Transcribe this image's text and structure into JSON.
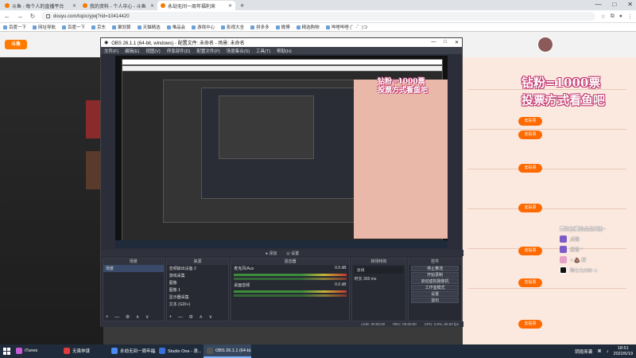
{
  "browser": {
    "tabs": [
      {
        "label": "斗鱼 - 每个人的直播平台",
        "active": false
      },
      {
        "label": "我的资料 - 个人中心 - 斗鱼",
        "active": false
      },
      {
        "label": "永劫无间一周年福利来",
        "active": true
      }
    ],
    "new_tab": "+",
    "window_controls": [
      "—",
      "□",
      "✕"
    ],
    "url": "douyu.com/topic/yjwj?rid=10414420",
    "bookmarks": [
      "百度一下",
      "网址导航",
      "百度一下",
      "京东",
      "聚划算",
      "天猫精选",
      "唯品会",
      "游戏中心",
      "影视大全",
      "拼多多",
      "微博",
      "精选购物",
      "哔哩哔哩 (゜-゜)つ"
    ]
  },
  "stream_overlay": {
    "title_line1": "钻粉=1000票",
    "title_line2": "投票方式看鱼吧",
    "follow_header": "喜欢主播的点点关注~",
    "follow_items": [
      "点歌",
      "房管 *",
      "+ 💩 群",
      "嗨七七030 ★"
    ]
  },
  "obs": {
    "title": "OBS 26.1.1 (64-bit, windows) - 配置文件: 未命名 - 场景: 未命名",
    "title_controls": [
      "—",
      "□",
      "✕"
    ],
    "menu": [
      "文件(F)",
      "编辑(E)",
      "视图(V)",
      "停靠部件(D)",
      "配置文件(P)",
      "场景集合(S)",
      "工具(T)",
      "帮助(H)"
    ],
    "mode_bar": [
      "● 添加",
      "◎ 设置"
    ],
    "docks": {
      "scenes": {
        "title": "场景",
        "items": [
          "场景"
        ]
      },
      "sources": {
        "title": "来源",
        "items": [
          "音频输出设备 2",
          "游戏采集",
          "图像",
          "图像 1",
          "显示器采集",
          "文本 (GDI+)"
        ]
      },
      "mixer": {
        "title": "混音器",
        "tracks": [
          {
            "name": "麦克风/Aux",
            "db": "0.0 dB"
          },
          {
            "name": "桌面音频",
            "db": "0.0 dB"
          }
        ]
      },
      "transitions": {
        "title": "转场特效",
        "type": "淡出",
        "duration_label": "时长",
        "duration": "300 ms"
      },
      "controls": {
        "title": "控件",
        "buttons": [
          "停止推流",
          "开始录制",
          "启动虚拟摄像机",
          "工作室模式",
          "设置",
          "退出"
        ]
      }
    },
    "dock_footer": "+ — ⚙ ∧ ∨",
    "status": [
      "LIVE: 00:00:00",
      "REC: 00:00:00",
      "CPU: 3.9%, 60.00 fps"
    ]
  },
  "taskbar": {
    "items": [
      {
        "label": "iTunes",
        "color": "#c85ad6",
        "active": false
      },
      {
        "label": "无畏仲谋",
        "color": "#e23b3b",
        "active": false
      },
      {
        "label": "永劫无间一周年福...",
        "color": "#4a8af4",
        "active": false
      },
      {
        "label": "Studio One - 浪...",
        "color": "#3a6fd8",
        "active": false
      },
      {
        "label": "OBS 26.1.1 (64-bi...",
        "color": "#555555",
        "active": true
      }
    ],
    "tray_text": "阴雨来袭",
    "time": "18:51",
    "date": "2022/6/19"
  },
  "colors": {
    "accent": "#ff6a00",
    "overlay_stroke": "#c0306a",
    "obs_bg": "#2b2e38"
  }
}
